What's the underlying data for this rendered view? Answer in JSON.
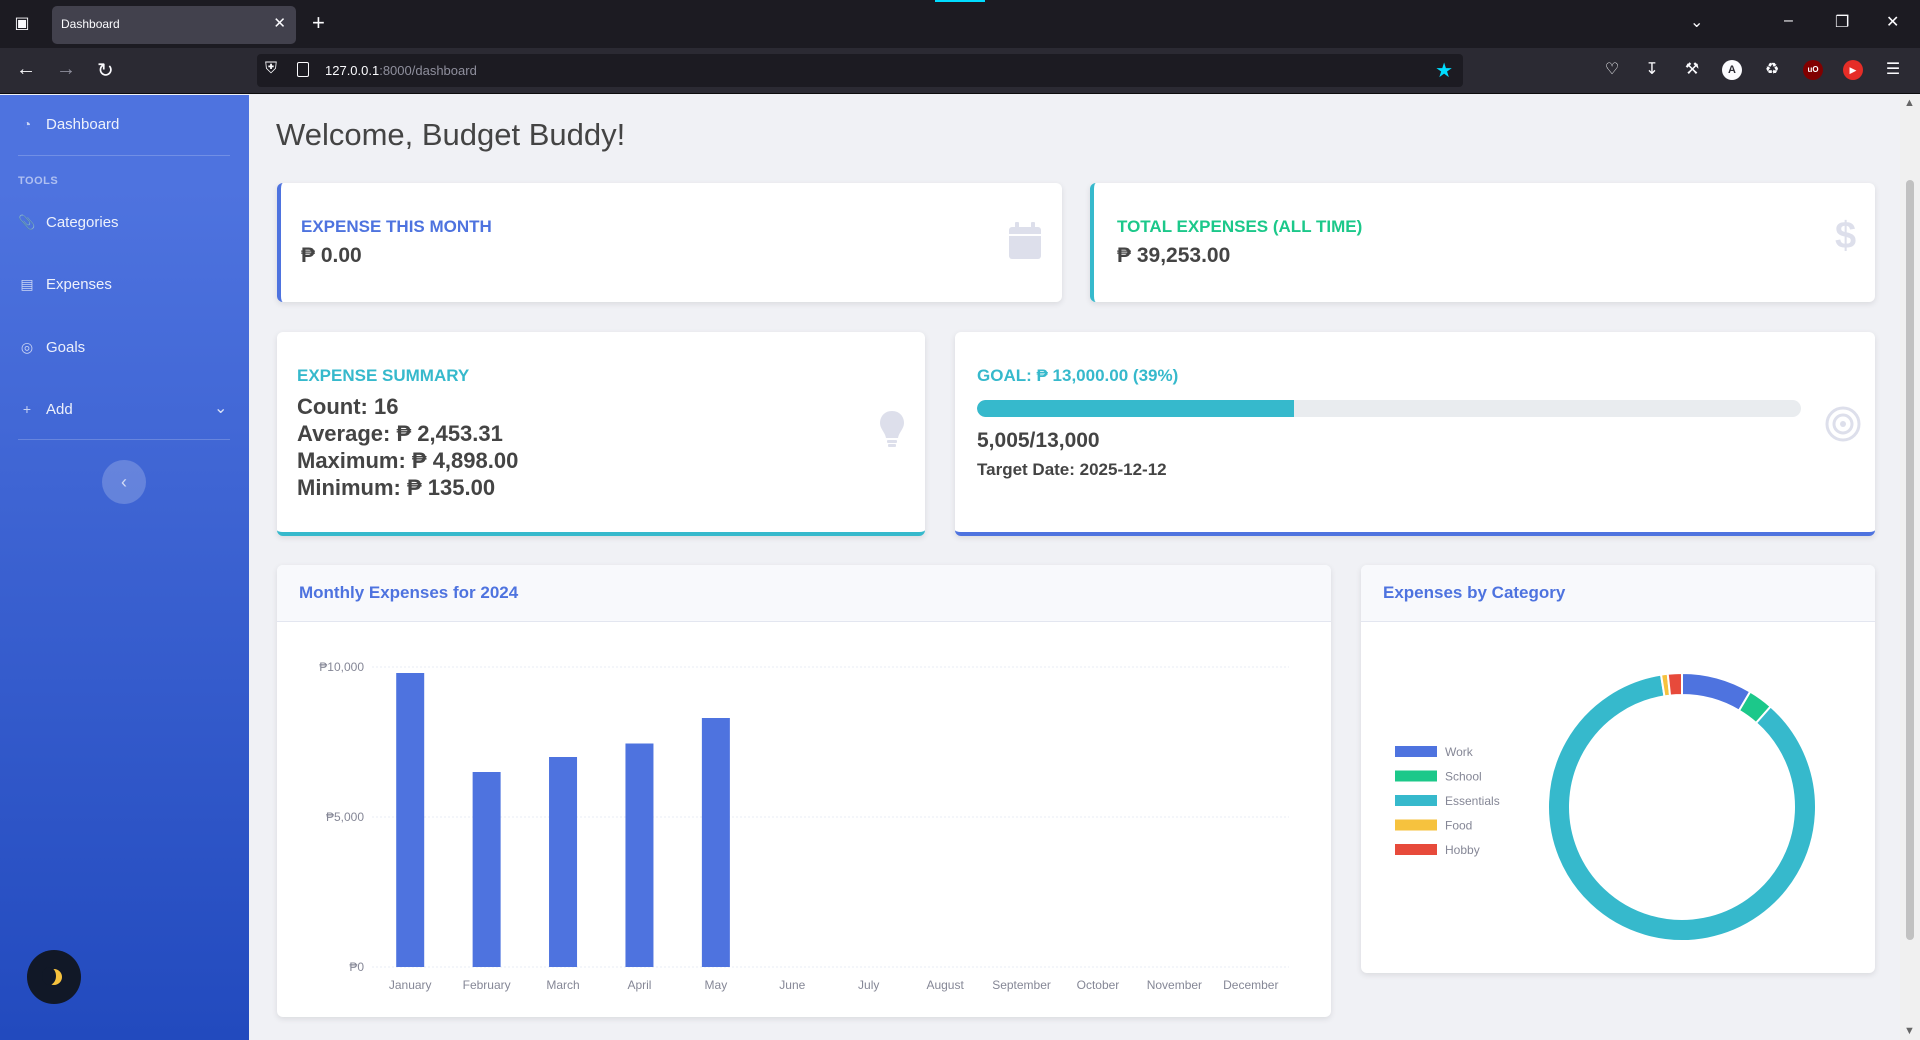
{
  "browser": {
    "tab_title": "Dashboard",
    "url_host": "127.0.0.1",
    "url_rest": ":8000/dashboard"
  },
  "sidebar": {
    "dashboard": "Dashboard",
    "heading": "TOOLS",
    "items": [
      {
        "label": "Categories",
        "icon": "paperclip-icon"
      },
      {
        "label": "Expenses",
        "icon": "card-icon"
      },
      {
        "label": "Goals",
        "icon": "target-icon"
      },
      {
        "label": "Add",
        "icon": "plus-icon"
      }
    ]
  },
  "page": {
    "title": "Welcome, Budget Buddy!"
  },
  "cards": {
    "month": {
      "label": "EXPENSE THIS MONTH",
      "value": "₱ 0.00",
      "color": "#4e73df"
    },
    "total": {
      "label": "TOTAL EXPENSES (ALL TIME)",
      "value": "₱ 39,253.00",
      "color": "#1cc88a"
    },
    "summary": {
      "label": "EXPENSE SUMMARY",
      "count": "Count: 16",
      "average": "Average: ₱ 2,453.31",
      "maximum": "Maximum: ₱ 4,898.00",
      "minimum": "Minimum: ₱ 135.00",
      "color": "#36b9cc"
    },
    "goal": {
      "label": "GOAL: ₱ 13,000.00 (39%)",
      "progress": 0.385,
      "amounts": "5,005/13,000",
      "target": "Target Date: 2025-12-12",
      "color": "#36b9cc"
    }
  },
  "monthly_chart_title": "Monthly Expenses for 2024",
  "category_chart_title": "Expenses by Category",
  "chart_data": [
    {
      "type": "bar",
      "title": "Monthly Expenses for 2024",
      "categories": [
        "January",
        "February",
        "March",
        "April",
        "May",
        "June",
        "July",
        "August",
        "September",
        "October",
        "November",
        "December"
      ],
      "values": [
        9800,
        6500,
        7000,
        7450,
        8300,
        0,
        0,
        0,
        0,
        0,
        0,
        0
      ],
      "ylim": [
        0,
        10000
      ],
      "yticks": [
        "₱0",
        "₱5,000",
        "₱10,000"
      ],
      "grid": true,
      "color": "#4e73df"
    },
    {
      "type": "pie",
      "title": "Expenses by Category",
      "labels": [
        "Work",
        "School",
        "Essentials",
        "Food",
        "Hobby"
      ],
      "values": [
        8.5,
        3.0,
        86.0,
        0.8,
        1.7
      ],
      "colors": [
        "#4e73df",
        "#1cc88a",
        "#36b9cc",
        "#f6c23e",
        "#e74a3b"
      ],
      "legend": "left"
    }
  ]
}
